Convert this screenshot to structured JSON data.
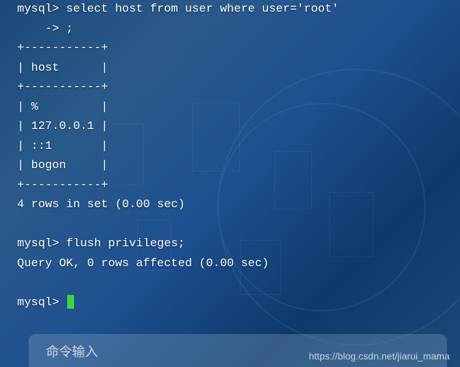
{
  "terminal": {
    "lines": [
      "mysql> select host from user where user='root'",
      "    -> ;",
      "+-----------+",
      "| host      |",
      "+-----------+",
      "| %         |",
      "| 127.0.0.1 |",
      "| ::1       |",
      "| bogon     |",
      "+-----------+",
      "4 rows in set (0.00 sec)",
      "",
      "mysql> flush privileges;",
      "Query OK, 0 rows affected (0.00 sec)",
      "",
      "mysql> "
    ],
    "prompt_final": "mysql> "
  },
  "bottom": {
    "label": "命令输入"
  },
  "watermark": {
    "text": "https://blog.csdn.net/jiarui_mama"
  }
}
